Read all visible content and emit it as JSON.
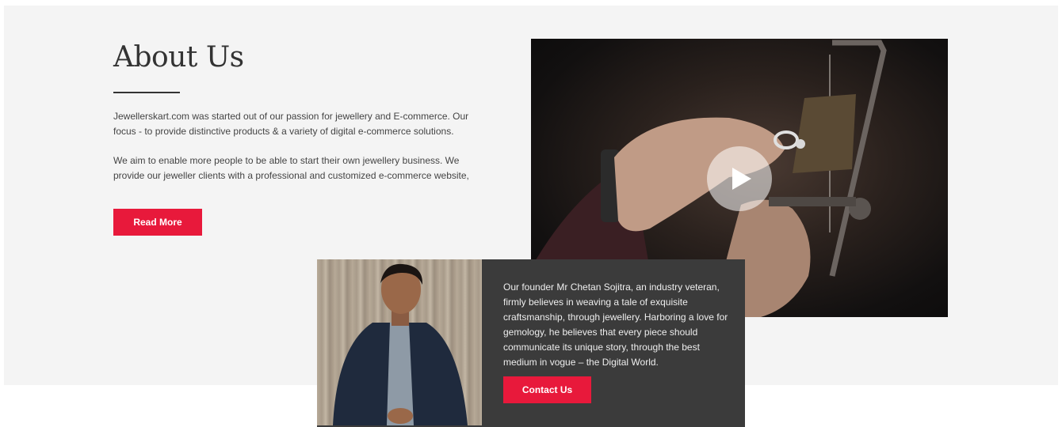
{
  "about": {
    "title": "About Us",
    "paragraph1": "Jewellerskart.com was started out of our passion for jewellery and E-commerce. Our focus - to provide distinctive products & a variety of digital e-commerce solutions.",
    "paragraph2": "We aim to enable more people to be able to start their own jewellery business. We provide our jeweller clients with a professional and customized e-commerce website,",
    "read_more_label": "Read More"
  },
  "video": {
    "play_icon": "play-icon"
  },
  "founder": {
    "text": "Our founder Mr Chetan Sojitra, an industry veteran, firmly believes in weaving a tale of exquisite craftsmanship, through jewellery. Harboring a love for gemology, he believes that every piece should communicate its unique story, through the best medium in vogue – the Digital World.",
    "contact_label": "Contact Us"
  },
  "colors": {
    "accent": "#e8193b",
    "section_bg": "#f4f4f4",
    "card_bg": "#3b3b3b"
  }
}
